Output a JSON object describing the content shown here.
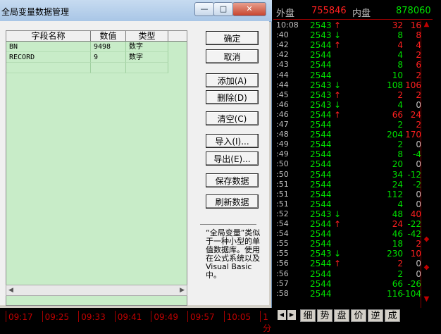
{
  "dialog": {
    "title": "全局变量数据管理",
    "window_buttons": {
      "minimize": "—",
      "maximize": "□",
      "close": "✕"
    },
    "table": {
      "headers": [
        "字段名称",
        "数值",
        "类型"
      ],
      "rows": [
        [
          "BN",
          "9498",
          "数字"
        ],
        [
          "RECORD",
          "9",
          "数字"
        ]
      ]
    },
    "buttons": {
      "ok": "确定",
      "cancel": "取消",
      "add": "添加(A)",
      "delete": "删除(D)",
      "clear": "清空(C)",
      "import": "导入(I)...",
      "export": "导出(E)...",
      "save": "保存数据",
      "refresh": "刷新数据"
    },
    "note": "“全局变量”类似于一种小型的单值数据库。使用在公式系统以及Visual Basic中。"
  },
  "summary": {
    "outer_label": "外盘",
    "outer_value": "755846",
    "inner_label": "内盘",
    "inner_value": "878060"
  },
  "ticks": [
    {
      "time": "10:08",
      "price": "2543",
      "dir": "up",
      "vol": "32",
      "chg": "16"
    },
    {
      "time": ":40",
      "price": "2543",
      "dir": "down",
      "vol": "8",
      "chg": "8"
    },
    {
      "time": ":42",
      "price": "2544",
      "dir": "up",
      "vol": "4",
      "chg": "4"
    },
    {
      "time": ":42",
      "price": "2544",
      "dir": "",
      "vol": "4",
      "chg": "2"
    },
    {
      "time": ":43",
      "price": "2544",
      "dir": "",
      "vol": "8",
      "chg": "6"
    },
    {
      "time": ":44",
      "price": "2544",
      "dir": "",
      "vol": "10",
      "chg": "2"
    },
    {
      "time": ":44",
      "price": "2543",
      "dir": "down",
      "vol": "108",
      "chg": "106"
    },
    {
      "time": ":45",
      "price": "2543",
      "dir": "up",
      "vol": "2",
      "chg": "2"
    },
    {
      "time": ":46",
      "price": "2543",
      "dir": "down",
      "vol": "4",
      "chg": "0"
    },
    {
      "time": ":46",
      "price": "2544",
      "dir": "up",
      "vol": "66",
      "chg": "24"
    },
    {
      "time": ":47",
      "price": "2544",
      "dir": "",
      "vol": "2",
      "chg": "2"
    },
    {
      "time": ":48",
      "price": "2544",
      "dir": "",
      "vol": "204",
      "chg": "170"
    },
    {
      "time": ":49",
      "price": "2544",
      "dir": "",
      "vol": "2",
      "chg": "0"
    },
    {
      "time": ":49",
      "price": "2544",
      "dir": "",
      "vol": "8",
      "chg": "-4"
    },
    {
      "time": ":50",
      "price": "2544",
      "dir": "",
      "vol": "20",
      "chg": "0"
    },
    {
      "time": ":50",
      "price": "2544",
      "dir": "",
      "vol": "34",
      "chg": "-12"
    },
    {
      "time": ":51",
      "price": "2544",
      "dir": "",
      "vol": "24",
      "chg": "-2"
    },
    {
      "time": ":51",
      "price": "2544",
      "dir": "",
      "vol": "112",
      "chg": "0"
    },
    {
      "time": ":51",
      "price": "2544",
      "dir": "",
      "vol": "4",
      "chg": "0"
    },
    {
      "time": ":52",
      "price": "2543",
      "dir": "down",
      "vol": "48",
      "chg": "40"
    },
    {
      "time": ":54",
      "price": "2544",
      "dir": "up",
      "vol": "24",
      "chg": "-22"
    },
    {
      "time": ":54",
      "price": "2544",
      "dir": "",
      "vol": "46",
      "chg": "-42"
    },
    {
      "time": ":55",
      "price": "2544",
      "dir": "",
      "vol": "18",
      "chg": "2"
    },
    {
      "time": ":55",
      "price": "2543",
      "dir": "down",
      "vol": "230",
      "chg": "10"
    },
    {
      "time": ":56",
      "price": "2544",
      "dir": "up",
      "vol": "2",
      "chg": "0"
    },
    {
      "time": ":56",
      "price": "2544",
      "dir": "",
      "vol": "2",
      "chg": "0"
    },
    {
      "time": ":57",
      "price": "2544",
      "dir": "",
      "vol": "66",
      "chg": "-26"
    },
    {
      "time": ":58",
      "price": "2544",
      "dir": "",
      "vol": "116",
      "chg": "-104"
    }
  ],
  "timebar": [
    "09:17",
    "09:25",
    "09:33",
    "09:41",
    "09:49",
    "09:57",
    "10:05",
    "1分"
  ],
  "tabs": [
    "细",
    "势",
    "盘",
    "价",
    "逆",
    "成"
  ],
  "colors": {
    "up": "#ff2020",
    "down": "#00e000",
    "neutral": "#c0c0c0",
    "grid_bg": "#c8ecc8"
  }
}
